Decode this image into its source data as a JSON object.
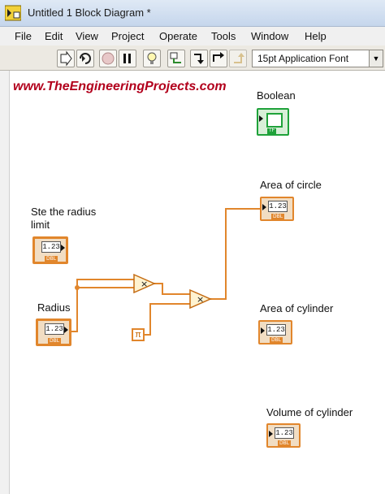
{
  "window": {
    "title": "Untitled 1 Block Diagram *"
  },
  "menu": [
    "File",
    "Edit",
    "View",
    "Project",
    "Operate",
    "Tools",
    "Window",
    "Help"
  ],
  "toolbar": {
    "buttons": [
      "run-arrow-icon",
      "run-continuously-icon",
      "abort-icon",
      "pause-icon",
      "highlight-execution-icon",
      "retain-wire-values-icon",
      "step-into-icon",
      "step-over-icon",
      "step-out-icon"
    ],
    "font": "15pt Application Font"
  },
  "diagram": {
    "watermark": "www.TheEngineeringProjects.com",
    "terminals": {
      "boolean_label": "Boolean",
      "boolean_tag": "TF",
      "area_circle_label": "Area of circle",
      "radius_limit_label_1": "Ste the radius",
      "radius_limit_label_2": "limit",
      "radius_label": "Radius",
      "area_cylinder_label": "Area of cylinder",
      "volume_cylinder_label": "Volume of cylinder",
      "numeric_text": "1.23",
      "numeric_type": "DBL"
    },
    "nodes": {
      "multiply_symbol": "×",
      "pi_symbol": "π"
    },
    "colors": {
      "numeric_wire": "#e1862c",
      "boolean": "#1fa23a",
      "watermark": "#b2001c"
    }
  }
}
